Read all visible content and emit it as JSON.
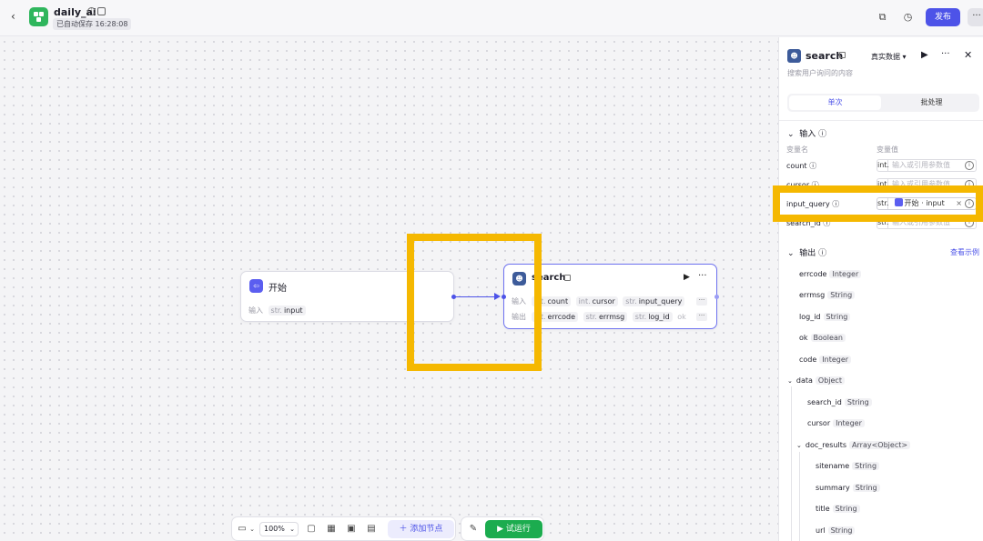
{
  "header": {
    "app_name": "daily_ai",
    "save_status": "已自动保存 16:28:08",
    "publish_label": "发布",
    "more_label": "···",
    "back_label": "‹"
  },
  "canvas": {
    "start_node": {
      "title": "开始",
      "input_label": "输入",
      "inputs": [
        {
          "type": "str.",
          "name": "input"
        }
      ]
    },
    "search_node": {
      "title": "search",
      "input_label": "输入",
      "output_label": "输出",
      "inputs": [
        {
          "type": "int.",
          "name": "count"
        },
        {
          "type": "int.",
          "name": "cursor"
        },
        {
          "type": "str.",
          "name": "input_query"
        }
      ],
      "outputs": [
        {
          "type": "int.",
          "name": "errcode"
        },
        {
          "type": "str.",
          "name": "errmsg"
        },
        {
          "type": "str.",
          "name": "log_id"
        },
        {
          "type": "",
          "name": "ok"
        }
      ]
    }
  },
  "toolbar": {
    "zoom": "100%",
    "add_node_label": "添加节点",
    "run_label": "试运行"
  },
  "panel": {
    "title": "search",
    "subtitle": "搜索用户询问的内容",
    "mode": "真实数据",
    "tab_single": "单次",
    "tab_batch": "批处理",
    "inputs_title": "输入",
    "col_name": "变量名",
    "col_value": "变量值",
    "inputs": [
      {
        "name": "count",
        "type": "int.",
        "placeholder": "输入或引用参数值"
      },
      {
        "name": "cursor",
        "type": "int.",
        "placeholder": "输入或引用参数值"
      },
      {
        "name": "input_query",
        "type": "str.",
        "ref_node": "开始",
        "ref_var": "input"
      },
      {
        "name": "search_id",
        "type": "str.",
        "placeholder": "输入或引用参数值"
      }
    ],
    "outputs_title": "输出",
    "example_link": "查看示例",
    "outputs": [
      {
        "name": "errcode",
        "type": "Integer"
      },
      {
        "name": "errmsg",
        "type": "String"
      },
      {
        "name": "log_id",
        "type": "String"
      },
      {
        "name": "ok",
        "type": "Boolean"
      },
      {
        "name": "code",
        "type": "Integer"
      },
      {
        "name": "data",
        "type": "Object"
      },
      {
        "name": "search_id",
        "type": "String"
      },
      {
        "name": "cursor",
        "type": "Integer"
      },
      {
        "name": "doc_results",
        "type": "Array<Object>"
      },
      {
        "name": "sitename",
        "type": "String"
      },
      {
        "name": "summary",
        "type": "String"
      },
      {
        "name": "title",
        "type": "String"
      },
      {
        "name": "url",
        "type": "String"
      }
    ]
  },
  "colors": {
    "accent": "#4d53e8",
    "run_green": "#1cac4f",
    "highlight": "#f5b800"
  }
}
